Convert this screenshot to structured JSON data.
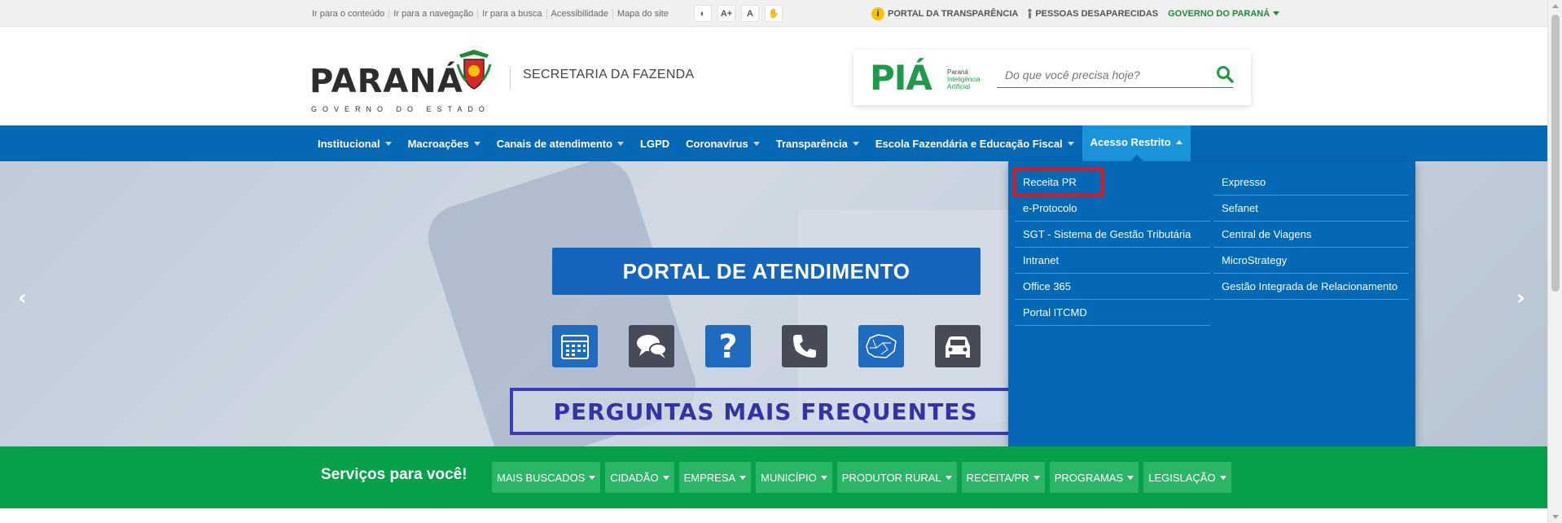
{
  "topbar": {
    "accessibility_links": [
      "Ir para o conteúdo",
      "Ir para a navegação",
      "Ir para a busca",
      "Acessibilidade",
      "Mapa do site"
    ],
    "tools": [
      {
        "icon": "contrast-icon",
        "label": "◐"
      },
      {
        "icon": "font-increase-icon",
        "label": "A+"
      },
      {
        "icon": "font-reset-icon",
        "label": "A"
      },
      {
        "icon": "sign-language-icon",
        "label": "✋"
      }
    ],
    "portal_transparencia": "PORTAL DA TRANSPARÊNCIA",
    "pessoas_desaparecidas": "PESSOAS DESAPARECIDAS",
    "governo_parana": "GOVERNO DO PARANÁ"
  },
  "header": {
    "logo_word": "PARANÁ",
    "logo_sub": "GOVERNO DO ESTADO",
    "secretaria": "SECRETARIA DA FAZENDA",
    "pia_word": "PIÁ",
    "pia_sub_1": "Paraná",
    "pia_sub_2": "Inteligência",
    "pia_sub_3": "Artificial",
    "search_placeholder": "Do que você precisa hoje?"
  },
  "nav": {
    "items": [
      {
        "label": "Institucional",
        "caret": true
      },
      {
        "label": "Macroações",
        "caret": true
      },
      {
        "label": "Canais de atendimento",
        "caret": true
      },
      {
        "label": "LGPD",
        "caret": false
      },
      {
        "label": "Coronavírus",
        "caret": true
      },
      {
        "label": "Transparência",
        "caret": true
      },
      {
        "label": "Escola Fazendária e Educação Fiscal",
        "caret": true
      },
      {
        "label": "Acesso Restrito",
        "caret": "up",
        "active": true
      }
    ]
  },
  "hero": {
    "portal_title": "PORTAL DE ATENDIMENTO",
    "icons": [
      "calendar-icon",
      "chat-icon",
      "question-icon",
      "phone-icon",
      "map-icon",
      "car-icon"
    ],
    "faq": "PERGUNTAS MAIS FREQUENTES",
    "prev_arrow": "‹",
    "next_arrow": "›"
  },
  "dropdown": {
    "left": [
      "Receita PR",
      "e-Protocolo",
      "SGT - Sistema de Gestão Tributária",
      "Intranet",
      "Office 365",
      "Portal ITCMD"
    ],
    "right": [
      "Expresso",
      "Sefanet",
      "Central de Viagens",
      "MicroStrategy",
      "Gestão Integrada de Relacionamento"
    ]
  },
  "services": {
    "title": "Serviços para você!",
    "chips": [
      "MAIS BUSCADOS",
      "CIDADÃO",
      "EMPRESA",
      "MUNICÍPIO",
      "PRODUTOR RURAL",
      "RECEITA/PR",
      "PROGRAMAS",
      "LEGISLAÇÃO"
    ]
  },
  "colors": {
    "nav_blue": "#0568b4",
    "nav_active": "#1a95dc",
    "services_green": "#06a04b",
    "highlight_red": "#e0191e",
    "faq_purple": "#3a3bb5"
  }
}
